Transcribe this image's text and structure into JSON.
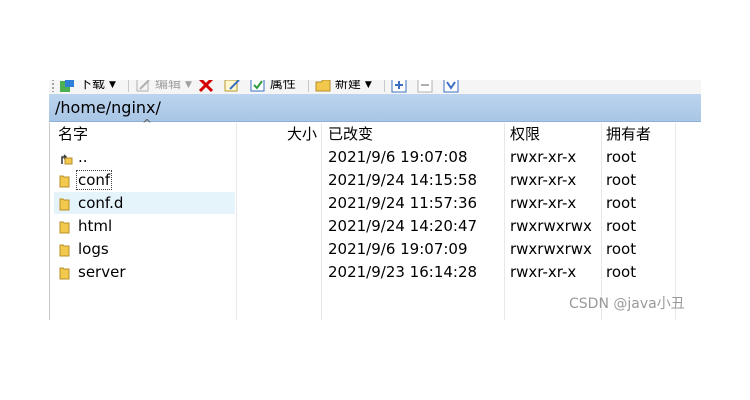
{
  "toolbar": {
    "download_label": "下载",
    "edit_label": "编辑",
    "properties_label": "属性",
    "new_label": "新建"
  },
  "path": "/home/nginx/",
  "columns": {
    "name": "名字",
    "size": "大小",
    "modified": "已改变",
    "permissions": "权限",
    "owner": "拥有者"
  },
  "files": [
    {
      "name": "..",
      "modified": "2021/9/6 19:07:08",
      "permissions": "rwxr-xr-x",
      "owner": "root",
      "icon": "parent-folder-icon"
    },
    {
      "name": "conf",
      "modified": "2021/9/24 14:15:58",
      "permissions": "rwxr-xr-x",
      "owner": "root",
      "icon": "folder-icon"
    },
    {
      "name": "conf.d",
      "modified": "2021/9/24 11:57:36",
      "permissions": "rwxr-xr-x",
      "owner": "root",
      "icon": "folder-icon"
    },
    {
      "name": "html",
      "modified": "2021/9/24 14:20:47",
      "permissions": "rwxrwxrwx",
      "owner": "root",
      "icon": "folder-icon"
    },
    {
      "name": "logs",
      "modified": "2021/9/6 19:07:09",
      "permissions": "rwxrwxrwx",
      "owner": "root",
      "icon": "folder-icon"
    },
    {
      "name": "server",
      "modified": "2021/9/23 16:14:28",
      "permissions": "rwxr-xr-x",
      "owner": "root",
      "icon": "folder-icon"
    }
  ],
  "watermark": "CSDN @java小丑",
  "colors": {
    "path_bar": "#bcd4ee",
    "selection": "#e5f3fb",
    "folder": "#f2c94c",
    "delete_red": "#d40000"
  }
}
